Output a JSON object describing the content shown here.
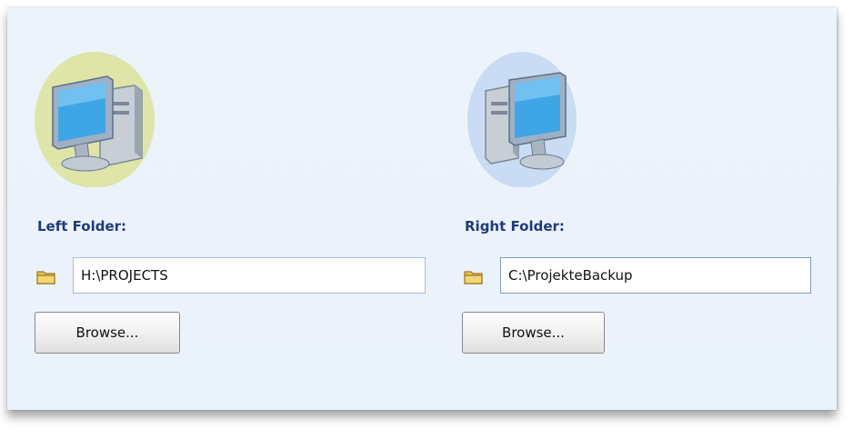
{
  "left": {
    "label": "Left Folder:",
    "path": "H:\\PROJECTS",
    "browse_label": "Browse...",
    "icon": "computer-icon",
    "icon_bg": "#dfe4a8"
  },
  "right": {
    "label": "Right Folder:",
    "path": "C:\\ProjekteBackup",
    "browse_label": "Browse...",
    "icon": "computer-icon",
    "icon_bg": "#c9dcf3"
  },
  "colors": {
    "label": "#1f3a7a",
    "panel_bg": "#edf3fb",
    "folder_icon": "#e8c25a"
  }
}
